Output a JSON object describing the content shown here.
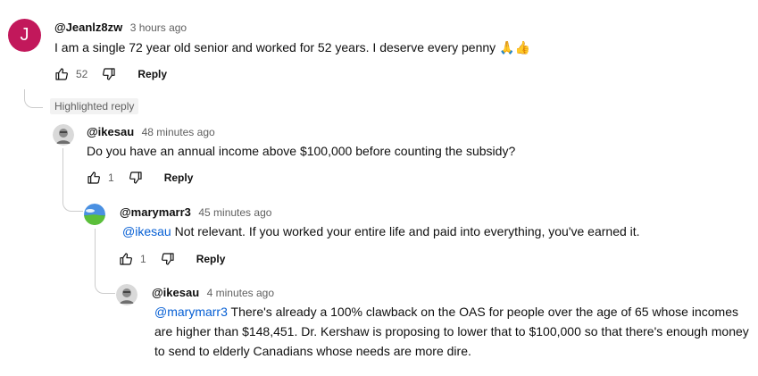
{
  "comments": [
    {
      "author": "@Jeanlz8zw",
      "time": "3 hours ago",
      "avatar_letter": "J",
      "text": "I am a single 72 year old senior and worked for 52 years.  I deserve every penny",
      "emoji": "🙏👍",
      "likes": "52",
      "reply_label": "Reply"
    },
    {
      "badge": "Highlighted reply",
      "author": "@ikesau",
      "time": "48 minutes ago",
      "text": "Do you have an annual income above $100,000 before counting the subsidy?",
      "likes": "1",
      "reply_label": "Reply"
    },
    {
      "author": "@marymarr3",
      "time": "45 minutes ago",
      "mention": "@ikesau",
      "text": " Not relevant. If you worked your entire life and paid into everything, you've earned it.",
      "likes": "1",
      "reply_label": "Reply"
    },
    {
      "author": "@ikesau",
      "time": "4 minutes ago",
      "mention": "@marymarr3",
      "text_line1": " There's already a 100% clawback on the OAS for people over the age of 65 whose incomes",
      "text_line2": "are higher than $148,451. Dr. Kershaw is proposing to lower that to $100,000 so that there's enough money",
      "text_line3": "to send to elderly Canadians whose needs are more dire."
    }
  ],
  "colors": {
    "avatar_j": "#c2185b",
    "mention": "#065fd4"
  },
  "icons": [
    "thumb-up-icon",
    "thumb-down-icon"
  ]
}
